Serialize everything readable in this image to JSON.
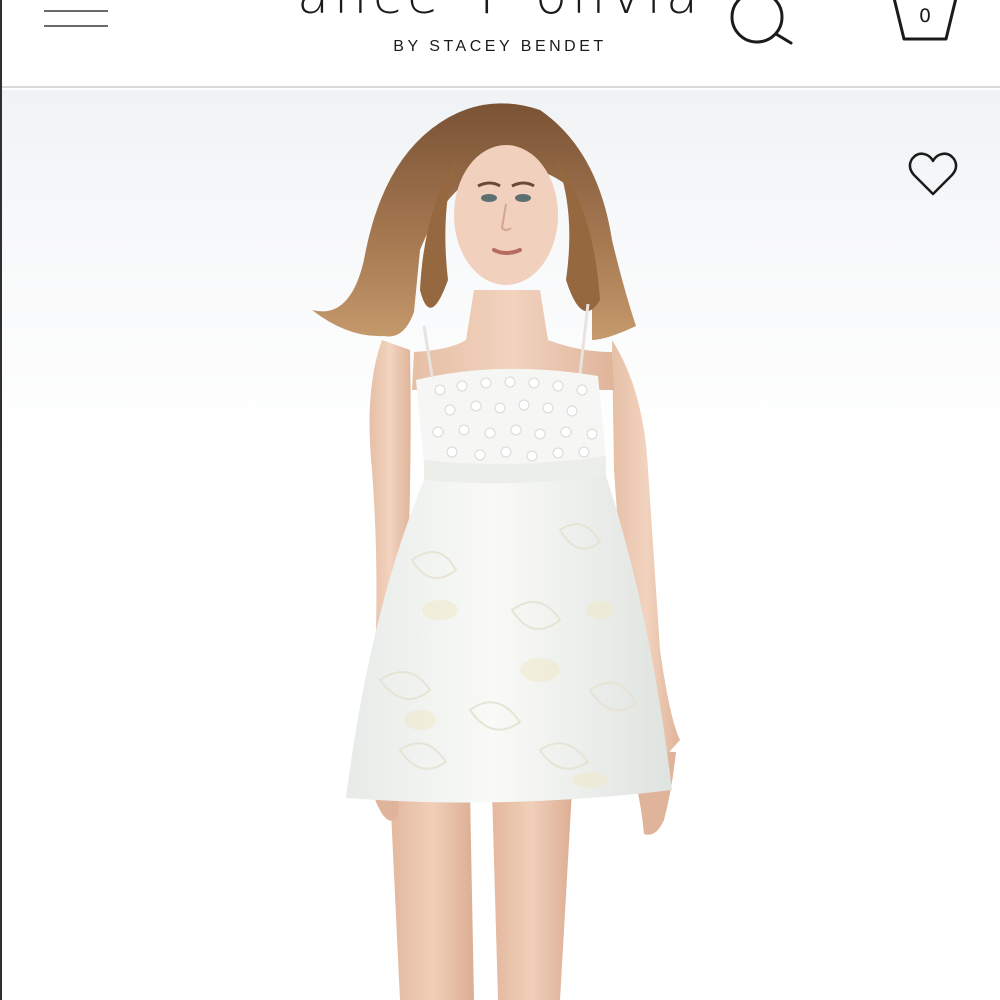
{
  "header": {
    "brand_name": "alice + olivia",
    "brand_subtitle": "BY STACEY BENDET",
    "menu_icon": "hamburger-menu-icon",
    "search_icon": "search-icon",
    "bag_icon": "shopping-bag-icon",
    "bag_count": "0"
  },
  "product": {
    "image": "model-in-white-jacquard-mini-dress",
    "wishlist_icon": "heart-outline-icon"
  },
  "colors": {
    "text": "#1b1b1b",
    "divider": "#d9d9d9",
    "background": "#ffffff"
  }
}
